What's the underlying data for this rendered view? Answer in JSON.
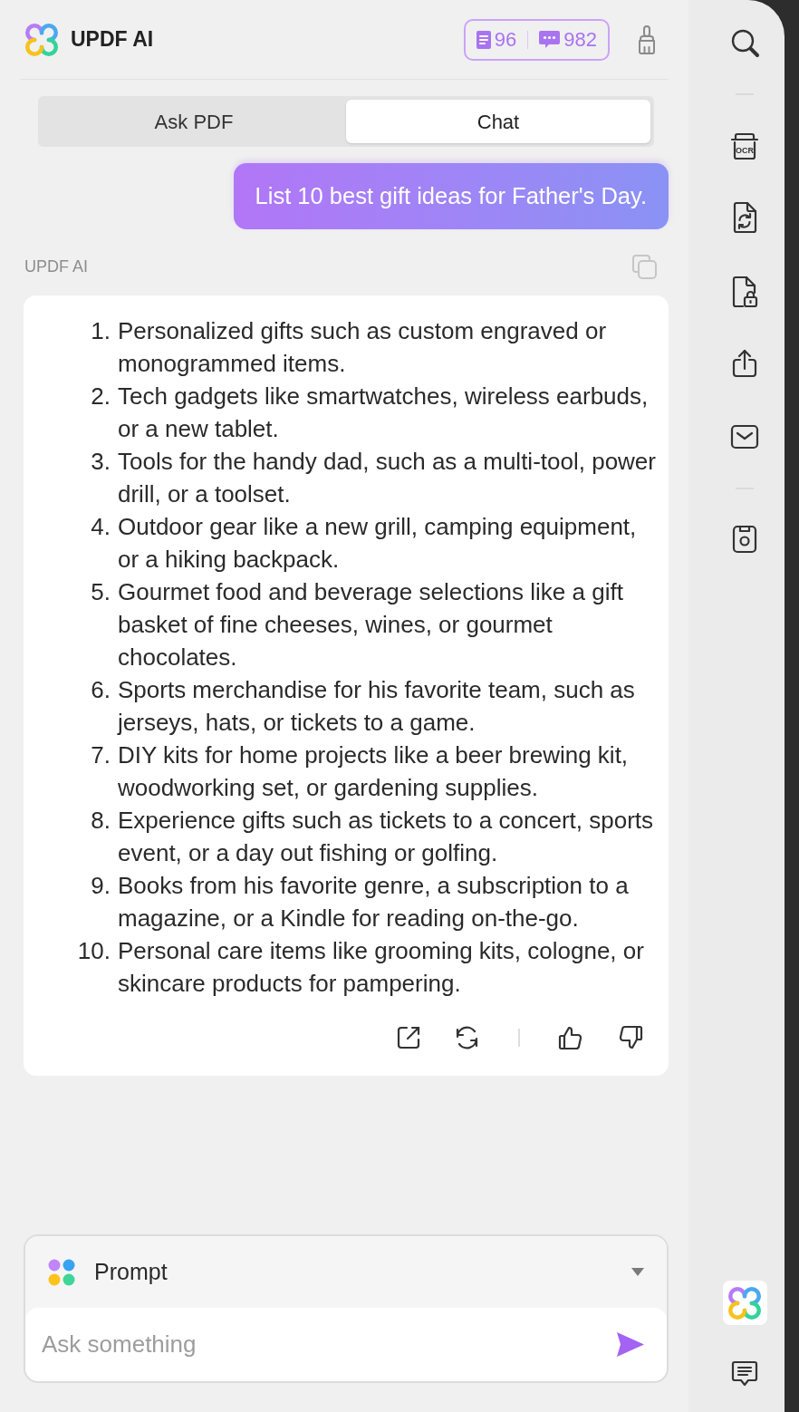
{
  "header": {
    "title": "UPDF AI",
    "credits": [
      {
        "kind": "document",
        "count": "96"
      },
      {
        "kind": "chat",
        "count": "982"
      }
    ]
  },
  "tabs": [
    {
      "label": "Ask PDF",
      "selected": false
    },
    {
      "label": "Chat",
      "selected": true
    }
  ],
  "conversation": [
    {
      "kind": "user",
      "text": "List 10 best gift ideas for Father's Day."
    },
    {
      "kind": "assistant",
      "sender": "UPDF AI",
      "items": [
        {
          "number": "1.",
          "text": "Personalized gifts such as custom engraved or monogrammed items."
        },
        {
          "number": "2.",
          "text": "Tech gadgets like smartwatches, wireless earbuds, or a new tablet."
        },
        {
          "number": "3.",
          "text": "Tools for the handy dad, such as a multi-tool, power drill, or a toolset."
        },
        {
          "number": "4.",
          "text": "Outdoor gear like a new grill, camping equipment, or a hiking backpack."
        },
        {
          "number": "5.",
          "text": "Gourmet food and beverage selections like a gift basket of fine cheeses, wines, or gourmet chocolates."
        },
        {
          "number": "6.",
          "text": "Sports merchandise for his favorite team, such as jerseys, hats, or tickets to a game."
        },
        {
          "number": "7.",
          "text": "DIY kits for home projects like a beer brewing kit, woodworking set, or gardening supplies."
        },
        {
          "number": "8.",
          "text": "Experience gifts such as tickets to a concert, sports event, or a day out fishing or golfing."
        },
        {
          "number": "9.",
          "text": "Books from his favorite genre, a subscription to a magazine, or a Kindle for reading on-the-go."
        },
        {
          "number": "10.",
          "text": "Personal care items like grooming kits, cologne, or skincare products for pampering."
        }
      ]
    }
  ],
  "composer": {
    "prompt_label": "Prompt",
    "placeholder": "Ask something"
  },
  "sidebar": {
    "ocr_label": "OCR"
  }
}
